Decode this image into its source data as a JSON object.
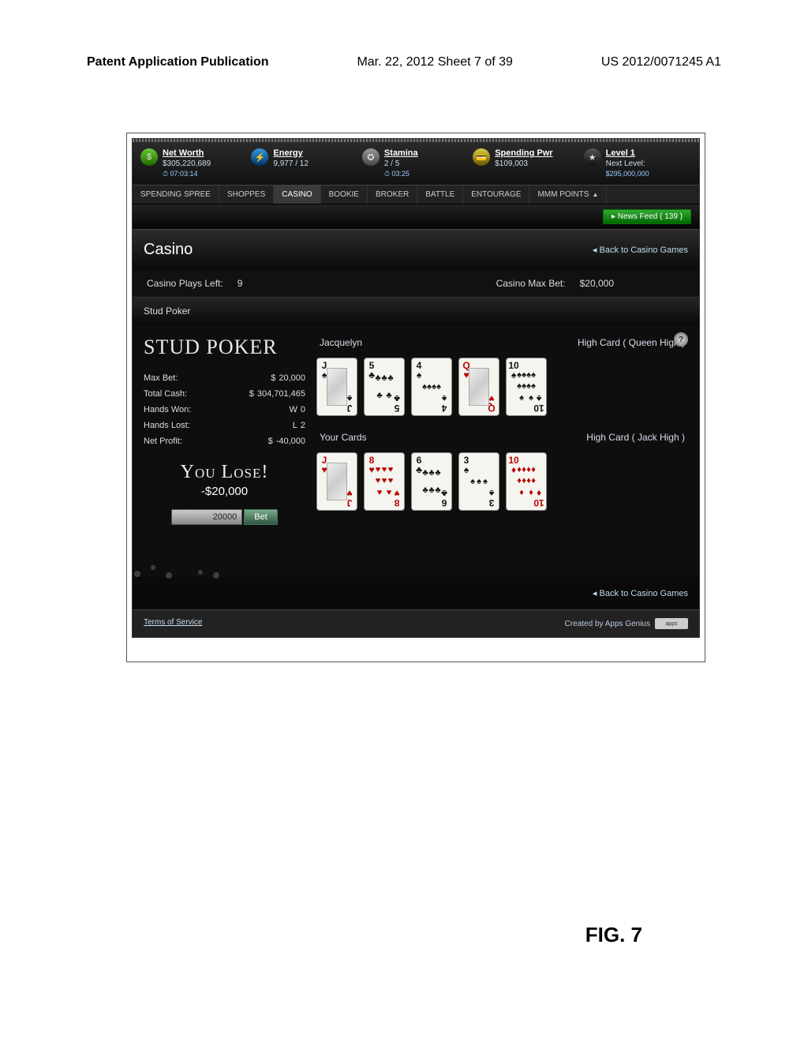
{
  "page_header": {
    "left": "Patent Application Publication",
    "mid": "Mar. 22, 2012  Sheet 7 of 39",
    "right": "US 2012/0071245 A1"
  },
  "figure_caption": "FIG. 7",
  "stats": {
    "net_worth": {
      "label": "Net Worth",
      "value": "$305,220,689",
      "timer": "⏱ 07:03:14"
    },
    "energy": {
      "label": "Energy",
      "value": "9,977 / 12"
    },
    "stamina": {
      "label": "Stamina",
      "value": "2 / 5",
      "timer": "⏱ 03:25"
    },
    "spending": {
      "label": "Spending Pwr",
      "value": "$109,003"
    },
    "level": {
      "label": "Level 1",
      "value": "Next Level:",
      "next": "$295,000,000"
    }
  },
  "tabs": [
    "SPENDING SPREE",
    "SHOPPES",
    "CASINO",
    "BOOKIE",
    "BROKER",
    "BATTLE",
    "ENTOURAGE",
    "MMM POINTS"
  ],
  "active_tab_index": 2,
  "news_feed": "▸ News Feed ( 139 )",
  "section_title": "Casino",
  "back_link": "◂ Back to Casino Games",
  "info_row": {
    "plays_left_label": "Casino Plays Left:",
    "plays_left_value": "9",
    "max_bet_label": "Casino Max Bet:",
    "max_bet_value": "$20,000"
  },
  "sub_header": "Stud Poker",
  "game": {
    "title": "Stud Poker",
    "stats": [
      {
        "k": "Max Bet:",
        "sym": "$",
        "v": "20,000"
      },
      {
        "k": "Total Cash:",
        "sym": "$",
        "v": "304,701,465"
      },
      {
        "k": "Hands Won:",
        "sym": "W",
        "v": "0"
      },
      {
        "k": "Hands Lost:",
        "sym": "L",
        "v": "2"
      },
      {
        "k": "Net Profit:",
        "sym": "$",
        "v": "-40,000"
      }
    ],
    "result": "You Lose!",
    "result_amount": "-$20,000",
    "bet_value": "20000",
    "bet_button": "Bet",
    "opponent": {
      "name": "Jacquelyn",
      "rank": "High Card ( Queen High )",
      "cards": [
        {
          "r": "J",
          "s": "♠",
          "count": 0,
          "face": true
        },
        {
          "r": "5",
          "s": "♣",
          "count": 5
        },
        {
          "r": "4",
          "s": "♠",
          "count": 4
        },
        {
          "r": "Q",
          "s": "♥",
          "count": 0,
          "face": true,
          "red": true
        },
        {
          "r": "10",
          "s": "♠",
          "count": 10
        }
      ]
    },
    "player": {
      "name": "Your Cards",
      "rank": "High Card ( Jack High )",
      "cards": [
        {
          "r": "J",
          "s": "♥",
          "count": 0,
          "face": true,
          "red": true
        },
        {
          "r": "8",
          "s": "♥",
          "count": 8,
          "red": true
        },
        {
          "r": "6",
          "s": "♣",
          "count": 6
        },
        {
          "r": "3",
          "s": "♠",
          "count": 3
        },
        {
          "r": "10",
          "s": "♦",
          "count": 10,
          "red": true
        }
      ]
    }
  },
  "footer": {
    "tos": "Terms of Service",
    "credit": "Created by Apps Genius",
    "logo": "apps"
  }
}
